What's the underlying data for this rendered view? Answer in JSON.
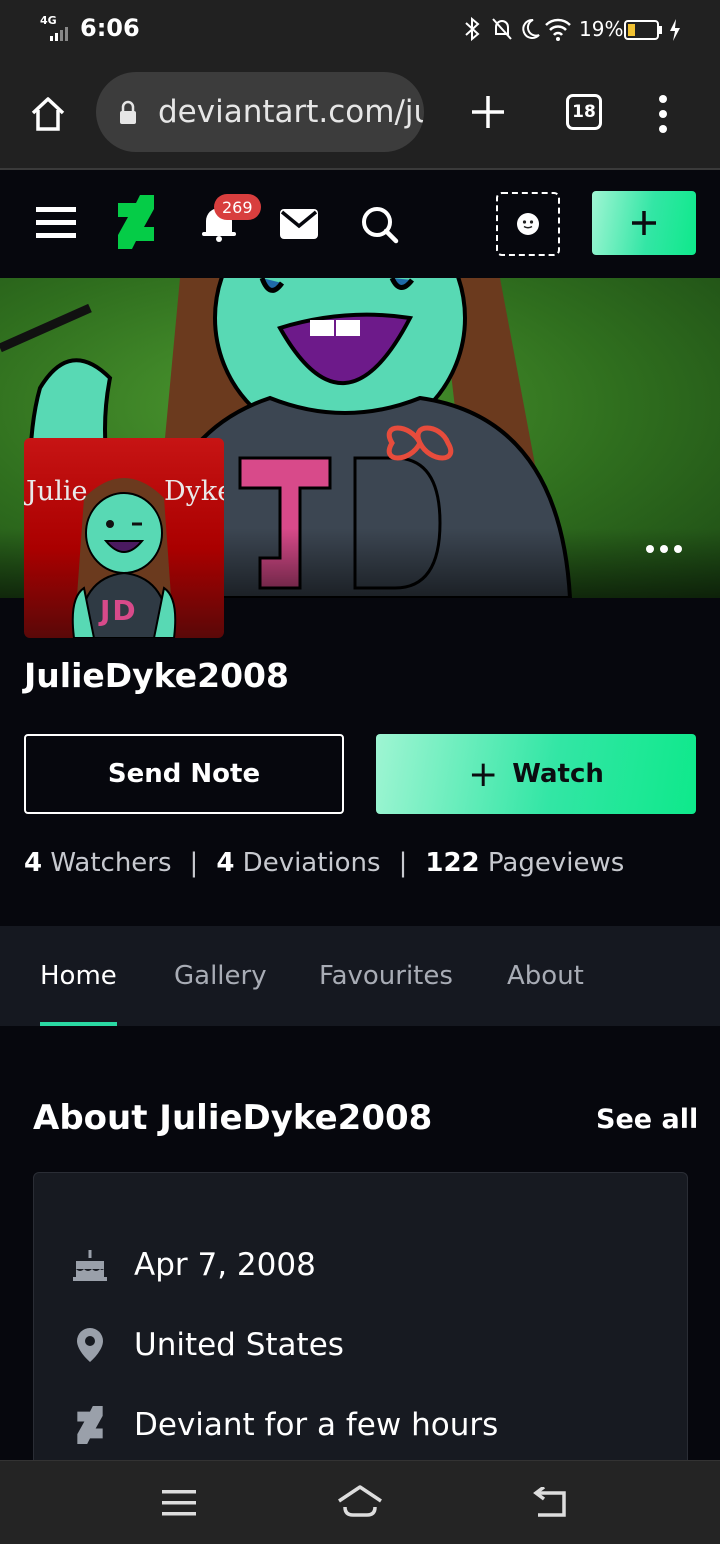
{
  "status_bar": {
    "network": "4G",
    "time": "6:06",
    "battery": "19%",
    "battery_level": 0.19
  },
  "browser": {
    "url": "deviantart.com/ju",
    "tab_count": "18"
  },
  "da_header": {
    "notification_count": "269"
  },
  "profile": {
    "username": "JulieDyke2008",
    "avatar_text_left": "Julie",
    "avatar_text_right": "Dyke",
    "avatar_shirt_text": "JD",
    "send_note_label": "Send Note",
    "watch_label": "Watch",
    "watch_plus": "+"
  },
  "stats": {
    "watchers_count": "4",
    "watchers_label": "Watchers",
    "deviations_count": "4",
    "deviations_label": "Deviations",
    "pageviews_count": "122",
    "pageviews_label": "Pageviews",
    "separator": "|"
  },
  "tabs": [
    {
      "label": "Home",
      "active": true
    },
    {
      "label": "Gallery",
      "active": false
    },
    {
      "label": "Favourites",
      "active": false
    },
    {
      "label": "About",
      "active": false
    }
  ],
  "about": {
    "title": "About JulieDyke2008",
    "see_all": "See all",
    "rows": [
      {
        "icon": "cake-icon",
        "text": "Apr 7, 2008"
      },
      {
        "icon": "location-pin-icon",
        "text": "United States"
      },
      {
        "icon": "deviantart-logo-icon",
        "text": "Deviant for a few hours"
      }
    ]
  },
  "colors": {
    "accent_green": "#0ee98b",
    "badge_red": "#d83e3e",
    "background": "#06070d"
  }
}
